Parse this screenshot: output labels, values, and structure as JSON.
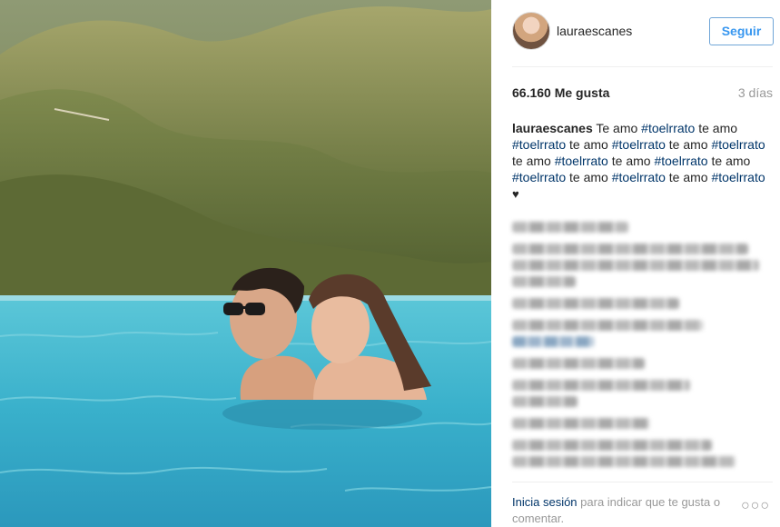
{
  "post": {
    "username": "lauraescanes",
    "follow_label": "Seguir",
    "likes": "66.160 Me gusta",
    "time": "3 días",
    "caption_user": "lauraescanes",
    "caption_parts": [
      {
        "text": " Te amo ",
        "tag": false
      },
      {
        "text": "#toelrrato",
        "tag": true
      },
      {
        "text": " te amo ",
        "tag": false
      },
      {
        "text": "#toelrrato",
        "tag": true
      },
      {
        "text": " te amo ",
        "tag": false
      },
      {
        "text": "#toelrrato",
        "tag": true
      },
      {
        "text": " te amo ",
        "tag": false
      },
      {
        "text": "#toelrrato",
        "tag": true
      },
      {
        "text": " te amo ",
        "tag": false
      },
      {
        "text": "#toelrrato",
        "tag": true
      },
      {
        "text": " te amo ",
        "tag": false
      },
      {
        "text": "#toelrrato",
        "tag": true
      },
      {
        "text": " te amo ",
        "tag": false
      },
      {
        "text": "#toelrrato",
        "tag": true
      },
      {
        "text": " te amo ",
        "tag": false
      },
      {
        "text": "#toelrrato",
        "tag": true
      },
      {
        "text": " te amo ",
        "tag": false
      },
      {
        "text": "#toelrrato",
        "tag": true
      },
      {
        "text": " ",
        "tag": false
      }
    ],
    "caption_heart": "♥"
  },
  "footer": {
    "login_label": "Inicia sesión",
    "rest": " para indicar que te gusta o comentar."
  },
  "more_label": "○○○",
  "colors": {
    "accent": "#3897f0",
    "link": "#003569",
    "muted": "#999999"
  }
}
